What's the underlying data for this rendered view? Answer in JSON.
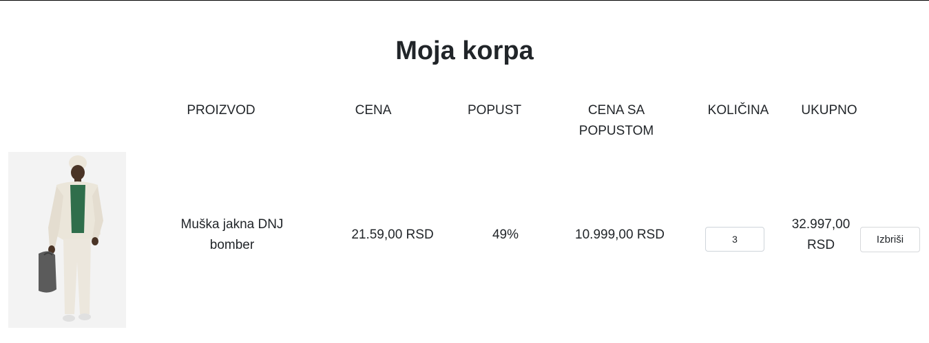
{
  "page": {
    "title": "Moja korpa"
  },
  "table": {
    "headers": {
      "product": "PROIZVOD",
      "price": "CENA",
      "discount": "POPUST",
      "discounted_price_line1": "CENA SA",
      "discounted_price_line2": "POPUSTOM",
      "quantity": "KOLIČINA",
      "total": "UKUPNO"
    },
    "rows": [
      {
        "image_icon": "product-photo",
        "name_line1": "Muška jakna DNJ",
        "name_line2": "bomber",
        "price": "21.59,00 RSD",
        "discount": "49%",
        "discounted_price": "10.999,00 RSD",
        "quantity": "3",
        "total_line1": "32.997,00",
        "total_line2": "RSD",
        "delete_label": "Izbriši"
      }
    ]
  }
}
